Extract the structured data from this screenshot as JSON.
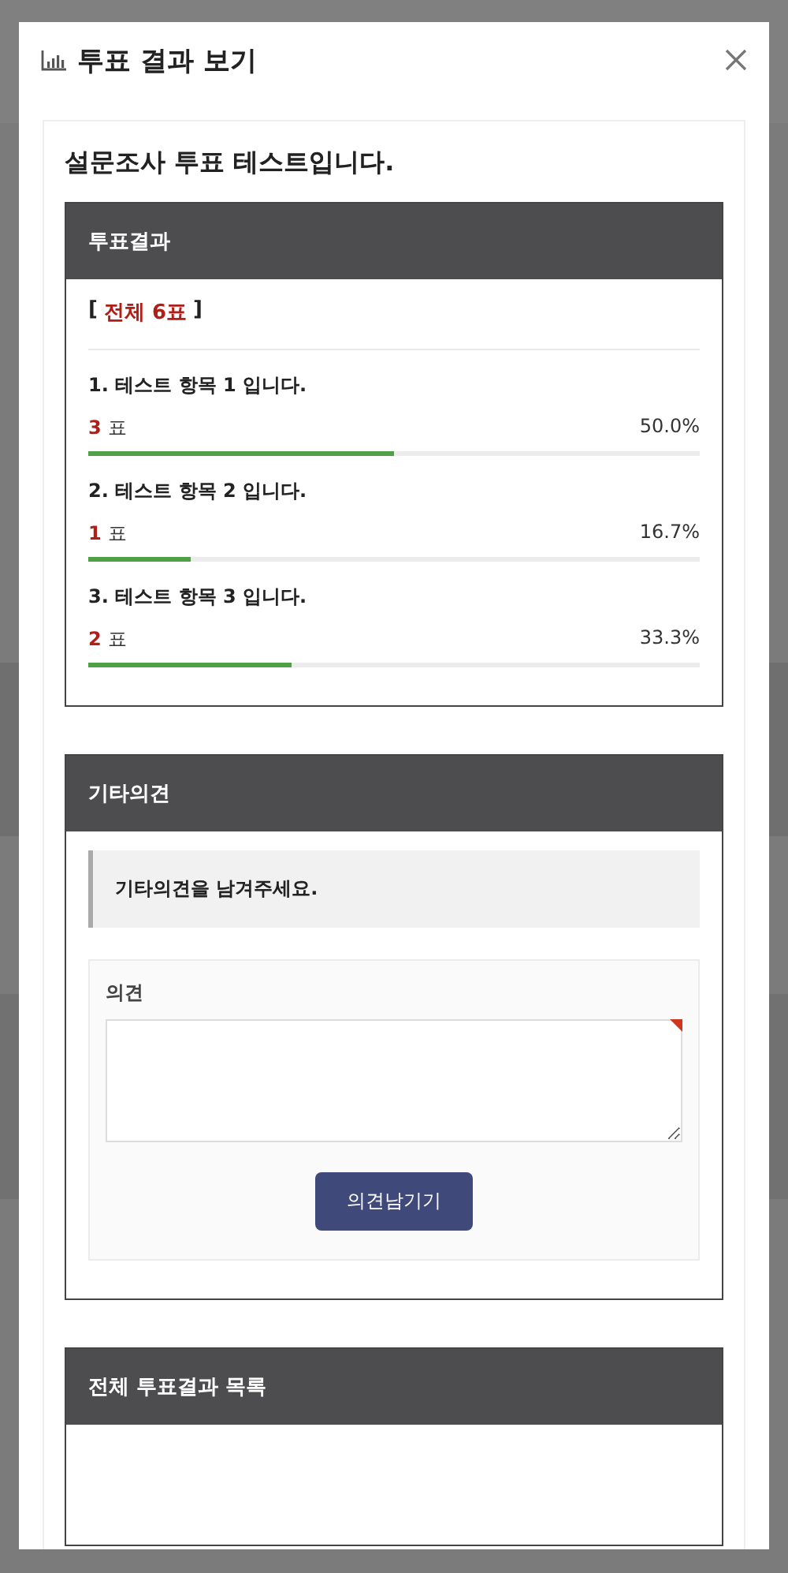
{
  "dialog": {
    "title": "투표 결과 보기"
  },
  "poll": {
    "question": "설문조사 투표 테스트입니다.",
    "results": {
      "heading": "투표결과",
      "total_open": "[",
      "total": "전체 6표",
      "total_close": "]",
      "items": [
        {
          "label": "1. 테스트 항목 1 입니다.",
          "count": "3",
          "unit": "표",
          "percent": "50.0%",
          "level": 0.5
        },
        {
          "label": "2. 테스트 항목 2 입니다.",
          "count": "1",
          "unit": "표",
          "percent": "16.7%",
          "level": 0.167
        },
        {
          "label": "3. 테스트 항목 3 입니다.",
          "count": "2",
          "unit": "표",
          "percent": "33.3%",
          "level": 0.333
        }
      ]
    },
    "opinion": {
      "heading": "기타의견",
      "notice": "기타의견을 남겨주세요.",
      "field_label": "의견",
      "required": true,
      "submit": "의견남기기"
    },
    "list": {
      "heading": "전체 투표결과 목록"
    }
  }
}
